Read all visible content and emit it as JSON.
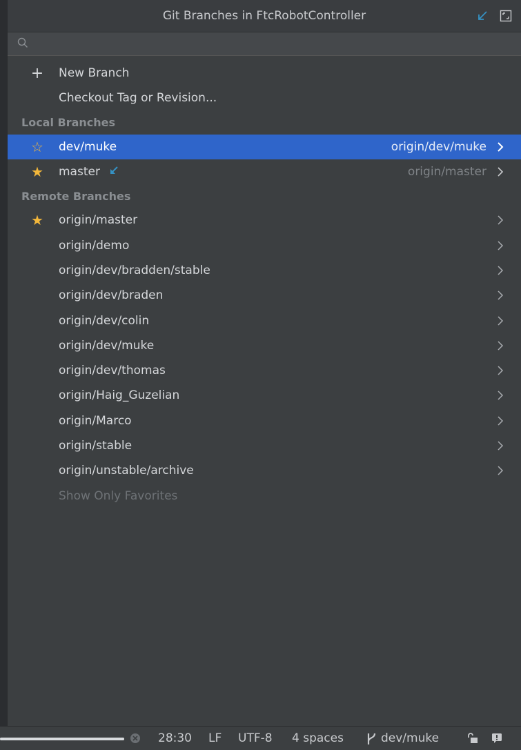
{
  "window": {
    "title": "Git Branches in FtcRobotController"
  },
  "search": {
    "value": "",
    "placeholder": ""
  },
  "actions": [
    {
      "label": "New Branch",
      "icon": "plus-icon"
    },
    {
      "label": "Checkout Tag or Revision...",
      "icon": ""
    }
  ],
  "local_section": "Local Branches",
  "local_branches": [
    {
      "name": "dev/muke",
      "tracking": "origin/dev/muke",
      "favorite": false,
      "selected": true
    },
    {
      "name": "master",
      "tracking": "origin/master",
      "favorite": true,
      "selected": false,
      "incoming": true
    }
  ],
  "remote_section": "Remote Branches",
  "remote_branches": [
    {
      "name": "origin/master",
      "favorite": true
    },
    {
      "name": "origin/demo",
      "favorite": false
    },
    {
      "name": "origin/dev/bradden/stable",
      "favorite": false
    },
    {
      "name": "origin/dev/braden",
      "favorite": false
    },
    {
      "name": "origin/dev/colin",
      "favorite": false
    },
    {
      "name": "origin/dev/muke",
      "favorite": false
    },
    {
      "name": "origin/dev/thomas",
      "favorite": false
    },
    {
      "name": "origin/Haig_Guzelian",
      "favorite": false
    },
    {
      "name": "origin/Marco",
      "favorite": false
    },
    {
      "name": "origin/stable",
      "favorite": false
    },
    {
      "name": "origin/unstable/archive",
      "favorite": false
    }
  ],
  "show_favorites": "Show Only Favorites",
  "status": {
    "position": "28:30",
    "line_ending": "LF",
    "encoding": "UTF-8",
    "indent": "4 spaces",
    "branch": "dev/muke"
  },
  "colors": {
    "selection": "#2f65ca",
    "star": "#f3b73b",
    "incoming": "#3592c4"
  }
}
